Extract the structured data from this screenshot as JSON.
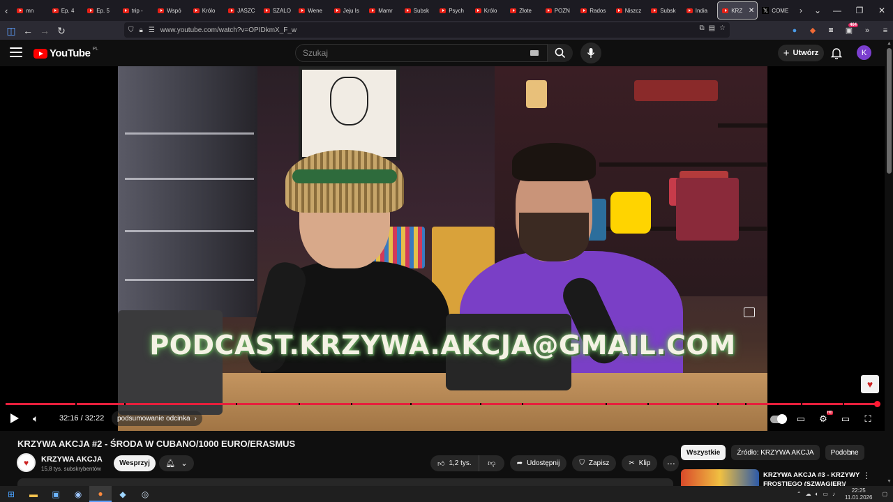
{
  "browser": {
    "tabs": [
      {
        "label": "mn"
      },
      {
        "label": "Ep. 4"
      },
      {
        "label": "Ep. 5"
      },
      {
        "label": "trip -"
      },
      {
        "label": "Wspó"
      },
      {
        "label": "Królo"
      },
      {
        "label": "JASZC"
      },
      {
        "label": "SZALO"
      },
      {
        "label": "Wene"
      },
      {
        "label": "Jeju Is"
      },
      {
        "label": "Mamr"
      },
      {
        "label": "Subsk"
      },
      {
        "label": "Psych"
      },
      {
        "label": "Królo"
      },
      {
        "label": "Złote"
      },
      {
        "label": "POZN"
      },
      {
        "label": "Rados"
      },
      {
        "label": "Niszcz"
      },
      {
        "label": "Subsk"
      },
      {
        "label": "India"
      }
    ],
    "active_tab": "KRZ",
    "x_tab": "COME",
    "url": "www.youtube.com/watch?v=OPIDkmX_F_w",
    "ext_badge": "464"
  },
  "youtube": {
    "logo": "YouTube",
    "country": "PL",
    "search_placeholder": "Szukaj",
    "create_label": "Utwórz",
    "avatar_letter": "K"
  },
  "player": {
    "overlay_text": "PODCAST.KRZYWA.AKCJA@GMAIL.COM",
    "time_current": "32:16",
    "time_total": "32:22",
    "time_display": "32:16 / 32:22",
    "chapter": "podsumowanie odcinka",
    "progress": 1.0,
    "hd_badge": "HD"
  },
  "video_info": {
    "title": "KRZYWA AKCJA #2 - ŚRODA W CUBANO/1000 EURO/ERASMUS",
    "channel": "KRZYWA AKCJA",
    "subscribers": "15,8 tys. subskrybentów",
    "support_label": "Wesprzyj",
    "likes": "1,2 tys.",
    "share_label": "Udostępnij",
    "save_label": "Zapisz",
    "clip_label": "Klip"
  },
  "sidebar": {
    "chips": [
      "Wszystkie",
      "Źródło: KRZYWA AKCJA",
      "Podobne"
    ],
    "rec_title": "KRZYWA AKCJA #3 - KRZYWY FROSTIEGO (SZWAGIER)/"
  },
  "taskbar": {
    "time": "22:25",
    "date": "11.01.2026"
  },
  "colors": {
    "accent_red": "#ff0000",
    "progress": "#e61f3c",
    "avatar": "#7b3fcf",
    "shirt": "#7a3fc6"
  }
}
